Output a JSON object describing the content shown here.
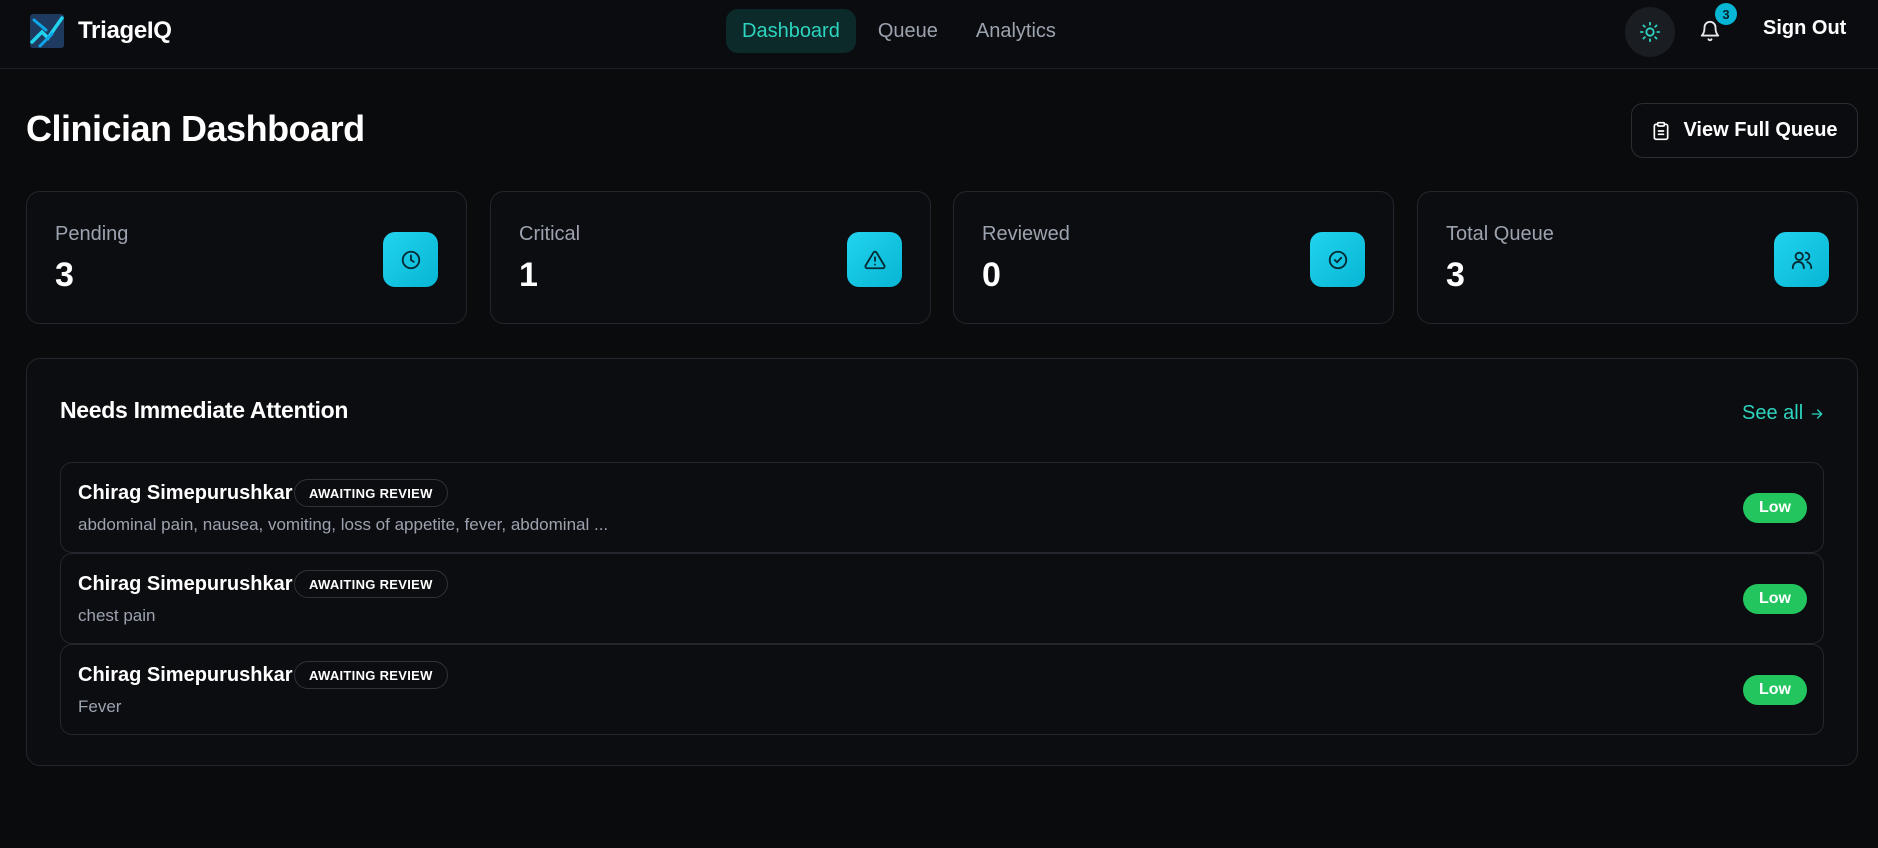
{
  "app": {
    "name": "TriageIQ"
  },
  "nav": {
    "links": [
      {
        "label": "Dashboard",
        "active": true
      },
      {
        "label": "Queue",
        "active": false
      },
      {
        "label": "Analytics",
        "active": false
      }
    ],
    "notification_count": "3",
    "sign_out_label": "Sign Out",
    "icons": {
      "theme": "sun-icon",
      "notifications": "bell-icon"
    }
  },
  "header": {
    "title": "Clinician Dashboard",
    "view_queue_label": "View Full Queue"
  },
  "stats": [
    {
      "label": "Pending",
      "value": "3",
      "icon": "clock-icon"
    },
    {
      "label": "Critical",
      "value": "1",
      "icon": "alert-triangle-icon"
    },
    {
      "label": "Reviewed",
      "value": "0",
      "icon": "check-circle-icon"
    },
    {
      "label": "Total Queue",
      "value": "3",
      "icon": "users-icon"
    }
  ],
  "attention": {
    "title": "Needs Immediate Attention",
    "see_all_label": "See all",
    "items": [
      {
        "name": "Chirag Simepurushkar",
        "status": "AWAITING REVIEW",
        "symptoms": "abdominal pain, nausea, vomiting, loss of appetite, fever, abdominal ...",
        "priority": "Low"
      },
      {
        "name": "Chirag Simepurushkar",
        "status": "AWAITING REVIEW",
        "symptoms": "chest pain",
        "priority": "Low"
      },
      {
        "name": "Chirag Simepurushkar",
        "status": "AWAITING REVIEW",
        "symptoms": "Fever",
        "priority": "Low"
      }
    ]
  },
  "colors": {
    "background": "#0a0b0d",
    "accent": "#2dd4bf",
    "stat_icon": "#22d3ee",
    "priority_low": "#22c55e"
  }
}
